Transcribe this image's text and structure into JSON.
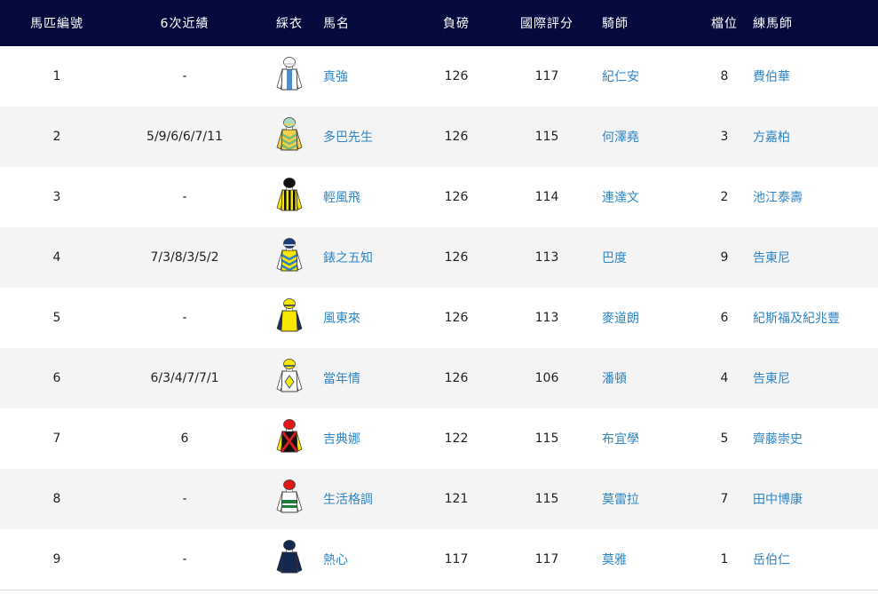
{
  "headers": [
    "馬匹編號",
    "6次近績",
    "綵衣",
    "馬名",
    "負磅",
    "國際評分",
    "騎師",
    "檔位",
    "練馬師"
  ],
  "colors": {
    "header_bg": "#040a3c",
    "link": "#2f86c6",
    "alt_row": "#f4f4f4"
  },
  "horses": [
    {
      "no": "1",
      "form": "-",
      "silk_icon": "white-body-blue-panel-silk",
      "silk": {
        "body": "#ffffff",
        "panel": "#4a8ed6",
        "sleeve": "#ffffff",
        "cap": "#ffffff",
        "capAccent": "#cccccc",
        "pattern": "panel"
      },
      "name": "真強",
      "weight": "126",
      "rating": "117",
      "jockey": "紀仁安",
      "draw": "8",
      "trainer": "費伯華"
    },
    {
      "no": "2",
      "form": "5/9/6/6/7/11",
      "silk_icon": "yellow-green-chevrons-silk",
      "silk": {
        "body": "#f2d04a",
        "stripe": "#7ab87a",
        "sleeve": "#f2d04a",
        "cap": "#a8dcc0",
        "capAccent": "#f2d04a",
        "pattern": "chevron"
      },
      "name": "多巴先生",
      "weight": "126",
      "rating": "115",
      "jockey": "何澤堯",
      "draw": "3",
      "trainer": "方嘉柏"
    },
    {
      "no": "3",
      "form": "-",
      "silk_icon": "yellow-black-stripes-silk",
      "silk": {
        "body": "#f6e600",
        "stripe": "#111111",
        "sleeve": "#f6e600",
        "cap": "#111111",
        "capAccent": "#111111",
        "pattern": "vstripes"
      },
      "name": "輕風飛",
      "weight": "126",
      "rating": "114",
      "jockey": "連達文",
      "draw": "2",
      "trainer": "池江泰壽"
    },
    {
      "no": "4",
      "form": "7/3/8/3/5/2",
      "silk_icon": "green-yellow-chevrons-silk",
      "silk": {
        "body": "#f6e600",
        "stripe": "#2f7fc6",
        "sleeve": "#ffffff",
        "cap": "#1c3d7a",
        "capAccent": "#ffffff",
        "pattern": "chevron"
      },
      "name": "錶之五知",
      "weight": "126",
      "rating": "113",
      "jockey": "巴度",
      "draw": "9",
      "trainer": "告東尼"
    },
    {
      "no": "5",
      "form": "-",
      "silk_icon": "yellow-navy-sleeves-silk",
      "silk": {
        "body": "#f6e600",
        "stripe": "#1c2d5a",
        "sleeve": "#1c2d5a",
        "cap": "#f6e600",
        "capAccent": "#1c2d5a",
        "pattern": "plain"
      },
      "name": "風東來",
      "weight": "126",
      "rating": "113",
      "jockey": "麥道朗",
      "draw": "6",
      "trainer": "紀斯福及紀兆豐"
    },
    {
      "no": "6",
      "form": "6/3/4/7/7/1",
      "silk_icon": "white-blue-check-diamond-silk",
      "silk": {
        "body": "#ffffff",
        "stripe": "#2f5fae",
        "sleeve": "#ffffff",
        "cap": "#f6e600",
        "capAccent": "#1c3d7a",
        "pattern": "diamond"
      },
      "name": "當年情",
      "weight": "126",
      "rating": "106",
      "jockey": "潘頓",
      "draw": "4",
      "trainer": "告東尼"
    },
    {
      "no": "7",
      "form": "6",
      "silk_icon": "black-red-cross-silk",
      "silk": {
        "body": "#111111",
        "stripe": "#d42020",
        "sleeve": "#f6e600",
        "cap": "#e01818",
        "capAccent": "#e01818",
        "pattern": "cross"
      },
      "name": "吉典娜",
      "weight": "122",
      "rating": "115",
      "jockey": "布宜學",
      "draw": "5",
      "trainer": "齊藤崇史"
    },
    {
      "no": "8",
      "form": "-",
      "silk_icon": "white-green-hoops-silk",
      "silk": {
        "body": "#ffffff",
        "stripe": "#1e7f3a",
        "sleeve": "#ffffff",
        "cap": "#e01818",
        "capAccent": "#e01818",
        "pattern": "hoops"
      },
      "name": "生活格調",
      "weight": "121",
      "rating": "115",
      "jockey": "莫雷拉",
      "draw": "7",
      "trainer": "田中博康"
    },
    {
      "no": "9",
      "form": "-",
      "silk_icon": "navy-plain-silk",
      "silk": {
        "body": "#14284f",
        "stripe": "#14284f",
        "sleeve": "#14284f",
        "cap": "#14284f",
        "capAccent": "#14284f",
        "pattern": "plain"
      },
      "name": "熱心",
      "weight": "117",
      "rating": "117",
      "jockey": "莫雅",
      "draw": "1",
      "trainer": "岳伯仁"
    }
  ]
}
